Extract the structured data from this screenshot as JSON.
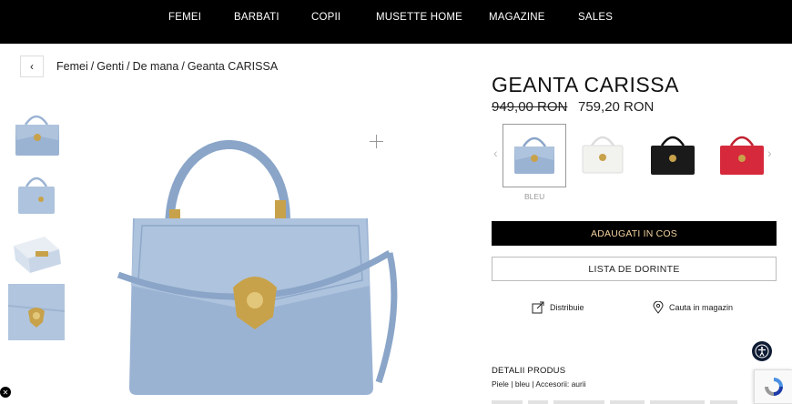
{
  "nav": {
    "items": [
      {
        "label": "FEMEI"
      },
      {
        "label": "BARBATI"
      },
      {
        "label": "COPII"
      },
      {
        "label": "MUSETTE HOME"
      },
      {
        "label": "MAGAZINE"
      },
      {
        "label": "SALES"
      }
    ]
  },
  "breadcrumb": [
    "Femei",
    "Genti",
    "De mana",
    "Geanta CARISSA"
  ],
  "product": {
    "title": "GEANTA CARISSA",
    "old_price": "949,00 RON",
    "new_price": "759,20 RON",
    "selected_color": "BLEU",
    "add_to_cart": "ADAUGATI IN COS",
    "wishlist": "LISTA DE DORINTE",
    "share": "Distribuie",
    "find_in_store": "Cauta in magazin",
    "details_title": "DETALII PRODUS",
    "details_text": "Piele | bleu | Accesorii: aurii"
  },
  "colors": {
    "brand_black": "#000000",
    "cart_text": "#f4d3a0",
    "bag_blue": "#9bb3d3",
    "bag_white": "#f2f2ef",
    "bag_black": "#1a1a1a",
    "bag_red": "#d62a3c",
    "gold": "#c8a24a"
  }
}
